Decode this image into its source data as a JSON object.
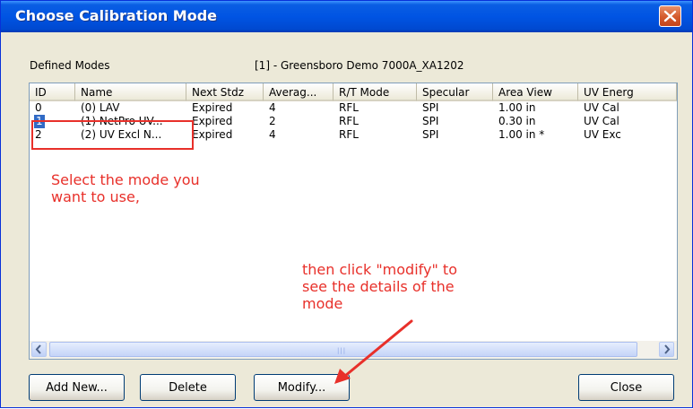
{
  "window": {
    "title": "Choose Calibration Mode"
  },
  "labels": {
    "defined_modes": "Defined Modes",
    "device": "[1] - Greensboro Demo 7000A_XA1202"
  },
  "table": {
    "columns": [
      "ID",
      "Name",
      "Next Stdz",
      "Averag...",
      "R/T Mode",
      "Specular",
      "Area View",
      "UV Energ"
    ],
    "rows": [
      [
        "0",
        "(0) LAV",
        "Expired",
        "4",
        "RFL",
        "SPI",
        "1.00 in",
        "UV Cal"
      ],
      [
        "1",
        "(1) NetPro UV...",
        "Expired",
        "2",
        "RFL",
        "SPI",
        "0.30 in",
        "UV Cal"
      ],
      [
        "2",
        "(2) UV Excl N...",
        "Expired",
        "4",
        "RFL",
        "SPI",
        "1.00 in *",
        "UV Exc"
      ]
    ],
    "selected_row": 1
  },
  "scrollbar": {
    "grip": "|||"
  },
  "buttons": {
    "add_new": "Add New...",
    "delete": "Delete",
    "modify": "Modify...",
    "close": "Close"
  },
  "annotations": {
    "select_line1": "Select the mode you",
    "select_line2": "want to use,",
    "modify_line1": "then click \"modify\" to",
    "modify_line2": "see the details of the",
    "modify_line3": "mode"
  },
  "colors": {
    "titlebar": "#0054e3",
    "selection": "#316ac5",
    "annotation": "#e8302a",
    "dialog": "#ece9d8"
  }
}
